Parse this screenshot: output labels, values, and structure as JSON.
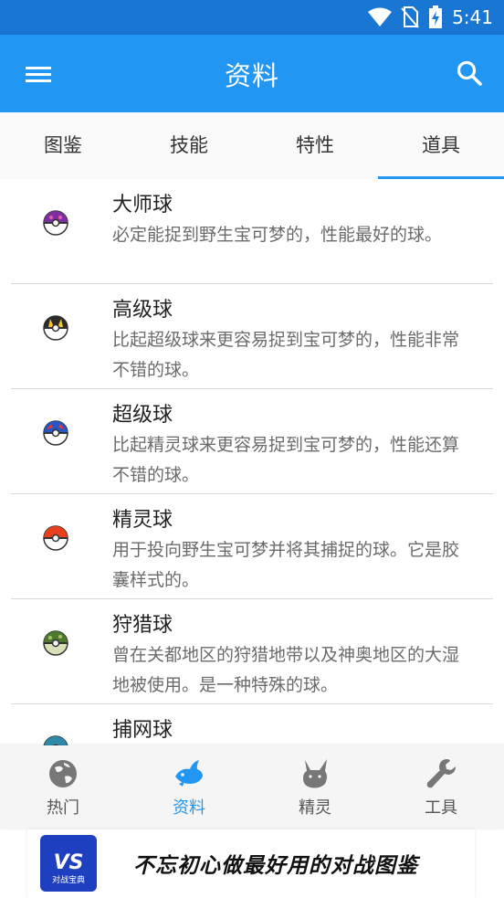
{
  "status_bar": {
    "time": "5:41",
    "icons": [
      "wifi-icon",
      "no-sim-icon",
      "battery-charging-icon"
    ]
  },
  "app_bar": {
    "title": "资料",
    "left_icon": "menu-icon",
    "right_icon": "search-icon"
  },
  "tabs": [
    {
      "label": "图鉴",
      "active": false
    },
    {
      "label": "技能",
      "active": false
    },
    {
      "label": "特性",
      "active": false
    },
    {
      "label": "道具",
      "active": true
    }
  ],
  "items": [
    {
      "name": "大师球",
      "desc": "必定能捉到野生宝可梦的，性能最好的球。",
      "icon": "master-ball-icon",
      "colors": [
        "#7b2fa0",
        "#ffffff"
      ]
    },
    {
      "name": "高级球",
      "desc": "比起超级球来更容易捉到宝可梦的，性能非常不错的球。",
      "icon": "ultra-ball-icon",
      "colors": [
        "#2b2b2b",
        "#ffffff"
      ]
    },
    {
      "name": "超级球",
      "desc": "比起精灵球来更容易捉到宝可梦的，性能还算不错的球。",
      "icon": "great-ball-icon",
      "colors": [
        "#2456c8",
        "#ffffff"
      ]
    },
    {
      "name": "精灵球",
      "desc": "用于投向野生宝可梦并将其捕捉的球。它是胶囊样式的。",
      "icon": "poke-ball-icon",
      "colors": [
        "#e8401f",
        "#ffffff"
      ]
    },
    {
      "name": "狩猎球",
      "desc": "曾在关都地区的狩猎地带以及神奥地区的大湿地被使用。是一种特殊的球。",
      "icon": "safari-ball-icon",
      "colors": [
        "#4c7a2e",
        "#ffffff"
      ]
    },
    {
      "name": "捕网球",
      "desc": "",
      "icon": "net-ball-icon",
      "colors": [
        "#2f8aa8",
        "#ffffff"
      ]
    }
  ],
  "bottom_nav": [
    {
      "label": "热门",
      "icon": "globe-icon",
      "active": false
    },
    {
      "label": "资料",
      "icon": "fish-icon",
      "active": true
    },
    {
      "label": "精灵",
      "icon": "pikachu-icon",
      "active": false
    },
    {
      "label": "工具",
      "icon": "wrench-icon",
      "active": false
    }
  ],
  "banner": {
    "logo_text": "VS",
    "logo_sub": "对战宝典",
    "text": "不忘初心做最好用的对战图鉴"
  },
  "colors": {
    "status_bar": "#1976d2",
    "primary": "#2196f3",
    "accent": "#2196f3"
  }
}
